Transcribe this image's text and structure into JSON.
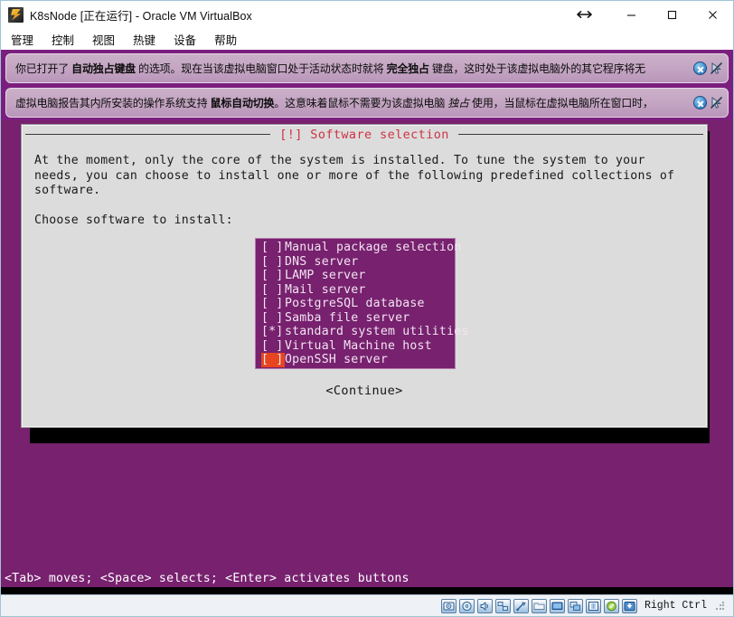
{
  "window": {
    "title": "K8sNode [正在运行] - Oracle VM VirtualBox",
    "app_icon": "virtualbox-icon",
    "controls": {
      "resize_indicator": "↔",
      "minimize": "—",
      "maximize": "□",
      "close": "✕"
    }
  },
  "menubar": {
    "items": [
      {
        "label": "管理"
      },
      {
        "label": "控制"
      },
      {
        "label": "视图"
      },
      {
        "label": "热键"
      },
      {
        "label": "设备"
      },
      {
        "label": "帮助"
      }
    ]
  },
  "notifications": [
    {
      "parts": [
        {
          "text": "你已打开了 ",
          "style": "normal"
        },
        {
          "text": "自动独占键盘",
          "style": "bold"
        },
        {
          "text": " 的选项。现在当该虚拟电脑窗口处于活动状态时就将 ",
          "style": "normal"
        },
        {
          "text": "完全独占",
          "style": "bold"
        },
        {
          "text": " 键盘，这时处于该虚拟电脑外的其它程序将无",
          "style": "normal"
        }
      ],
      "close_icon": "close-circle-icon",
      "second_icon": "cursor-disabled-icon"
    },
    {
      "parts": [
        {
          "text": "虚拟电脑报告其内所安装的操作系统支持 ",
          "style": "normal"
        },
        {
          "text": "鼠标自动切换",
          "style": "bold"
        },
        {
          "text": "。这意味着鼠标不需要为该虚拟电脑 ",
          "style": "normal"
        },
        {
          "text": "独占",
          "style": "italic"
        },
        {
          "text": " 使用，当鼠标在虚拟电脑所在窗口时，",
          "style": "normal"
        }
      ],
      "close_icon": "close-circle-icon",
      "second_icon": "cursor-disabled-icon"
    }
  ],
  "installer": {
    "dialog_title": "[!] Software selection",
    "paragraph": "At the moment, only the core of the system is installed. To tune the system to your\nneeds, you can choose to install one or more of the following predefined collections of\nsoftware.",
    "prompt": "Choose software to install:",
    "options": [
      {
        "checkbox": "[ ]",
        "label": "Manual package selection",
        "checked": false,
        "cursor": false
      },
      {
        "checkbox": "[ ]",
        "label": "DNS server",
        "checked": false,
        "cursor": false
      },
      {
        "checkbox": "[ ]",
        "label": "LAMP server",
        "checked": false,
        "cursor": false
      },
      {
        "checkbox": "[ ]",
        "label": "Mail server",
        "checked": false,
        "cursor": false
      },
      {
        "checkbox": "[ ]",
        "label": "PostgreSQL database",
        "checked": false,
        "cursor": false
      },
      {
        "checkbox": "[ ]",
        "label": "Samba file server",
        "checked": false,
        "cursor": false
      },
      {
        "checkbox": "[*]",
        "label": "standard system utilities",
        "checked": true,
        "cursor": false
      },
      {
        "checkbox": "[ ]",
        "label": "Virtual Machine host",
        "checked": false,
        "cursor": false
      },
      {
        "checkbox": "[ ]",
        "label": "OpenSSH server",
        "checked": false,
        "cursor": true
      }
    ],
    "continue_button": "<Continue>",
    "hint": "<Tab> moves; <Space> selects; <Enter> activates buttons"
  },
  "statusbar": {
    "icons": [
      "hard-disk-icon",
      "optical-disk-icon",
      "audio-icon",
      "network-icon",
      "usb-icon",
      "shared-folder-icon",
      "display-icon",
      "remote-display-icon",
      "recording-icon",
      "guest-additions-icon",
      "host-key-icon"
    ],
    "host_key_label": "Right Ctrl"
  },
  "colors": {
    "guest_background": "#77216f",
    "dialog_background": "#dcdcdc",
    "dialog_title": "#cc3344",
    "cursor_highlight": "#e8451f",
    "notification_background": "#c3a4c2",
    "window_chrome": "#ffffff"
  }
}
